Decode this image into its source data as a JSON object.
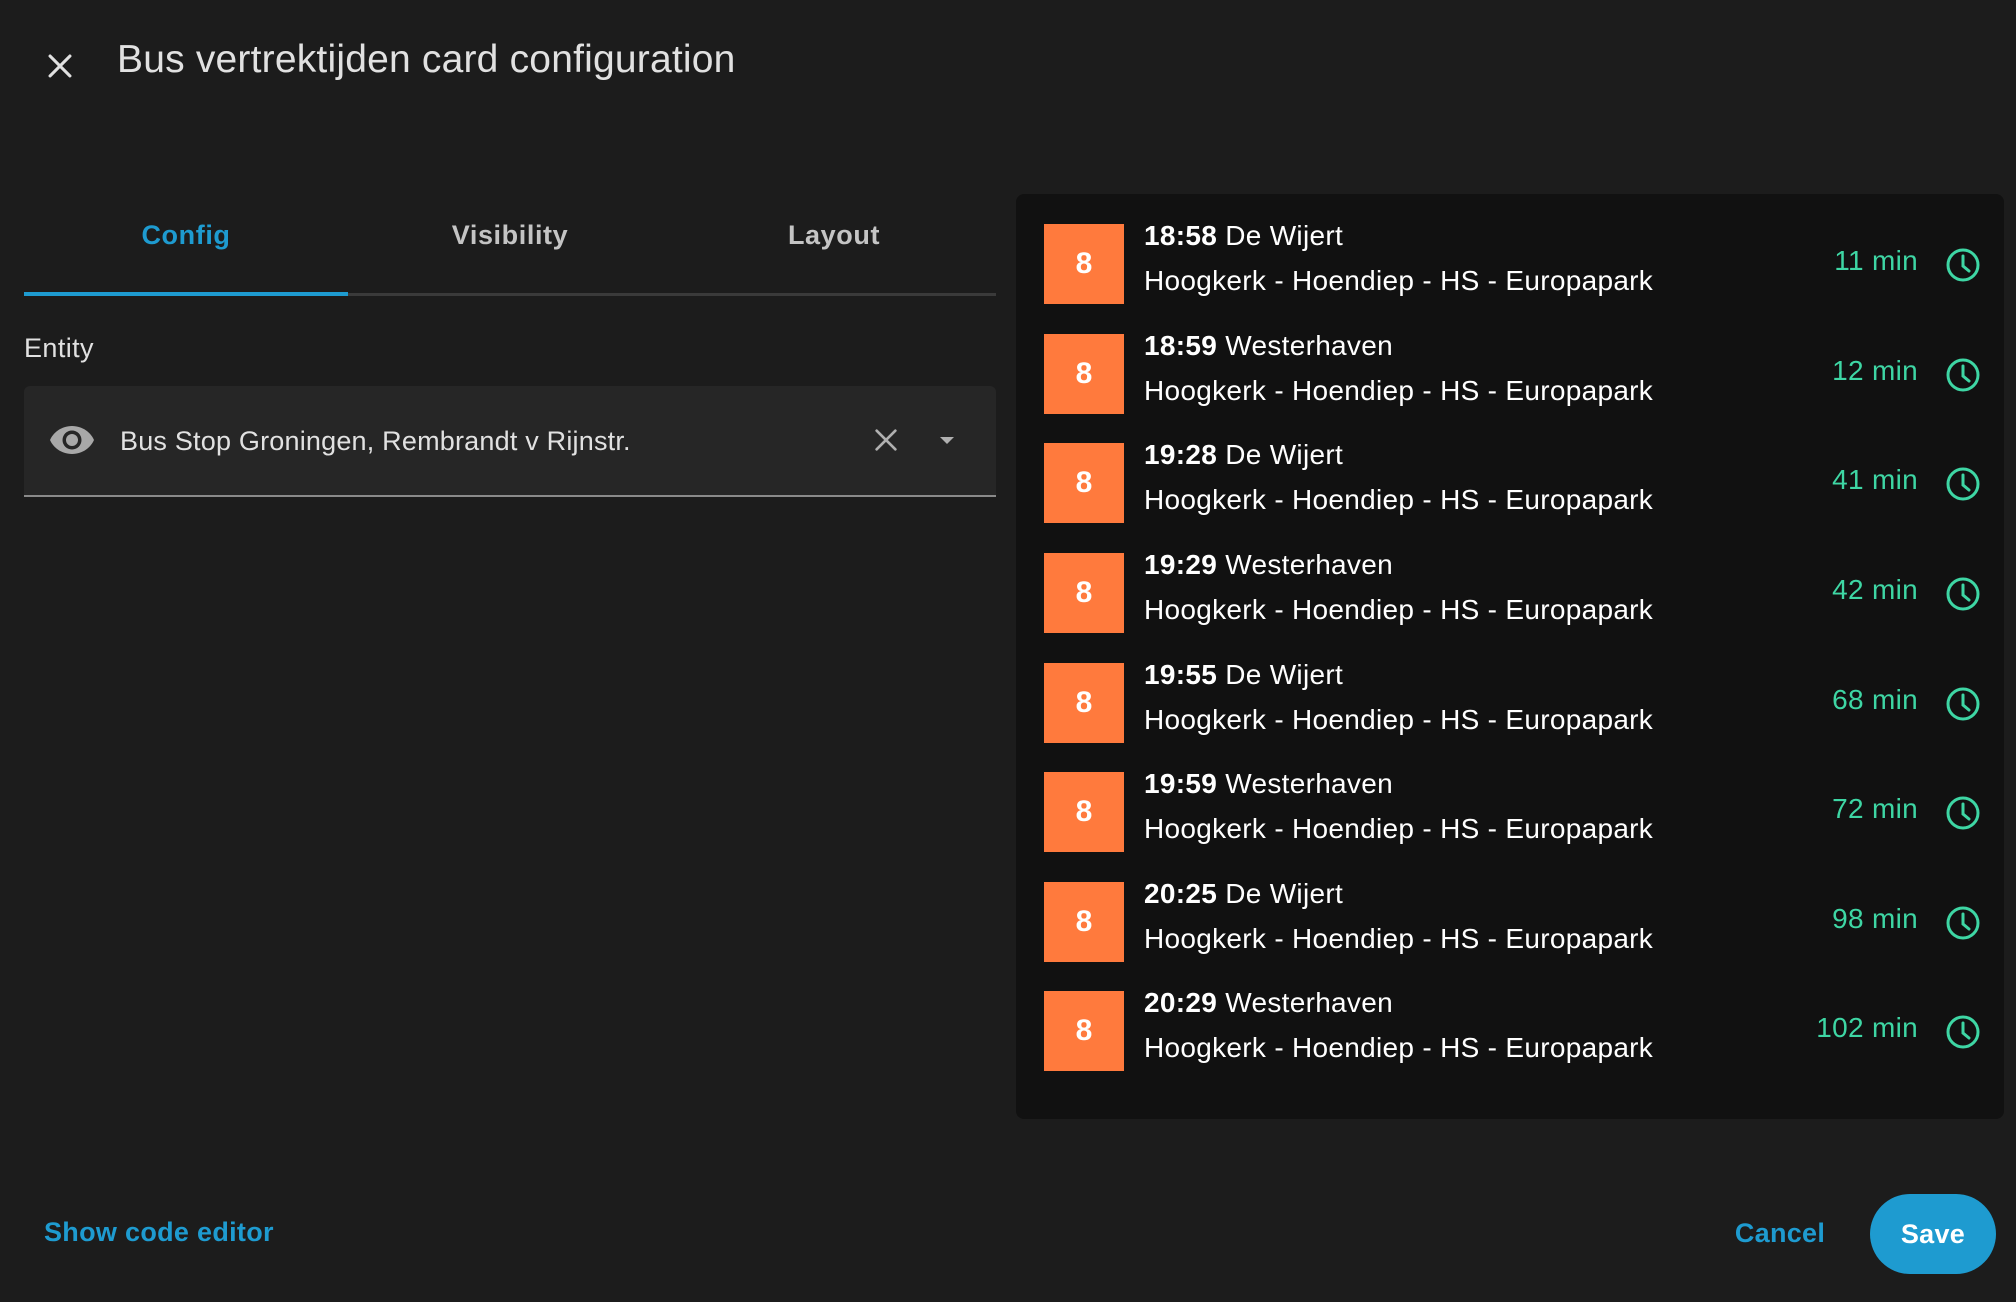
{
  "dialog": {
    "title": "Bus vertrektijden card configuration"
  },
  "tabs": [
    {
      "label": "Config",
      "active": true
    },
    {
      "label": "Visibility",
      "active": false
    },
    {
      "label": "Layout",
      "active": false
    }
  ],
  "entity": {
    "label": "Entity",
    "value": "Bus Stop Groningen, Rembrandt v Rijnstr."
  },
  "departures": [
    {
      "line": "8",
      "time": "18:58",
      "destination": "De Wijert",
      "route": "Hoogkerk - Hoendiep - HS - Europapark",
      "minutes": "11 min"
    },
    {
      "line": "8",
      "time": "18:59",
      "destination": "Westerhaven",
      "route": "Hoogkerk - Hoendiep - HS - Europapark",
      "minutes": "12 min"
    },
    {
      "line": "8",
      "time": "19:28",
      "destination": "De Wijert",
      "route": "Hoogkerk - Hoendiep - HS - Europapark",
      "minutes": "41 min"
    },
    {
      "line": "8",
      "time": "19:29",
      "destination": "Westerhaven",
      "route": "Hoogkerk - Hoendiep - HS - Europapark",
      "minutes": "42 min"
    },
    {
      "line": "8",
      "time": "19:55",
      "destination": "De Wijert",
      "route": "Hoogkerk - Hoendiep - HS - Europapark",
      "minutes": "68 min"
    },
    {
      "line": "8",
      "time": "19:59",
      "destination": "Westerhaven",
      "route": "Hoogkerk - Hoendiep - HS - Europapark",
      "minutes": "72 min"
    },
    {
      "line": "8",
      "time": "20:25",
      "destination": "De Wijert",
      "route": "Hoogkerk - Hoendiep - HS - Europapark",
      "minutes": "98 min"
    },
    {
      "line": "8",
      "time": "20:29",
      "destination": "Westerhaven",
      "route": "Hoogkerk - Hoendiep - HS - Europapark",
      "minutes": "102 min"
    }
  ],
  "footer": {
    "code_editor_label": "Show code editor",
    "cancel_label": "Cancel",
    "save_label": "Save"
  },
  "icons": {
    "close": "close-icon",
    "entity": "eye-icon",
    "clear": "clear-icon",
    "dropdown": "menu-down-icon",
    "departure": "clock-icon"
  },
  "colors": {
    "background": "#1c1c1c",
    "accent": "#1e9bd0",
    "line_badge": "#ff7a3d",
    "minutes": "#3ed6a4",
    "card": "#111111"
  }
}
